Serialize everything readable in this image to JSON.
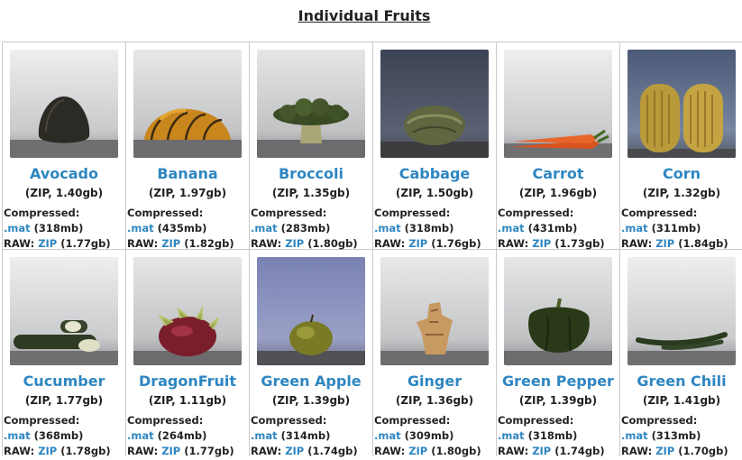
{
  "page": {
    "title": "Individual Fruits"
  },
  "labels": {
    "compressed": "Compressed:",
    "raw": "RAW:",
    "mat": ".mat",
    "zip": "ZIP"
  },
  "fruits": [
    {
      "name": "Avocado",
      "zip_size": "(ZIP, 1.40gb)",
      "mat_size": "(318mb)",
      "raw_size": "(1.77gb)"
    },
    {
      "name": "Banana",
      "zip_size": "(ZIP, 1.97gb)",
      "mat_size": "(435mb)",
      "raw_size": "(1.82gb)"
    },
    {
      "name": "Broccoli",
      "zip_size": "(ZIP, 1.35gb)",
      "mat_size": "(283mb)",
      "raw_size": "(1.80gb)"
    },
    {
      "name": "Cabbage",
      "zip_size": "(ZIP, 1.50gb)",
      "mat_size": "(318mb)",
      "raw_size": "(1.76gb)"
    },
    {
      "name": "Carrot",
      "zip_size": "(ZIP, 1.96gb)",
      "mat_size": "(431mb)",
      "raw_size": "(1.73gb)"
    },
    {
      "name": "Corn",
      "zip_size": "(ZIP, 1.32gb)",
      "mat_size": "(311mb)",
      "raw_size": "(1.84gb)"
    },
    {
      "name": "Cucumber",
      "zip_size": "(ZIP, 1.77gb)",
      "mat_size": "(368mb)",
      "raw_size": "(1.78gb)"
    },
    {
      "name": "DragonFruit",
      "zip_size": "(ZIP, 1.11gb)",
      "mat_size": "(264mb)",
      "raw_size": "(1.77gb)"
    },
    {
      "name": "Green Apple",
      "zip_size": "(ZIP, 1.39gb)",
      "mat_size": "(314mb)",
      "raw_size": "(1.74gb)"
    },
    {
      "name": "Ginger",
      "zip_size": "(ZIP, 1.36gb)",
      "mat_size": "(309mb)",
      "raw_size": "(1.80gb)"
    },
    {
      "name": "Green Pepper",
      "zip_size": "(ZIP, 1.39gb)",
      "mat_size": "(318mb)",
      "raw_size": "(1.74gb)"
    },
    {
      "name": "Green Chili",
      "zip_size": "(ZIP, 1.41gb)",
      "mat_size": "(313mb)",
      "raw_size": "(1.70gb)"
    }
  ]
}
